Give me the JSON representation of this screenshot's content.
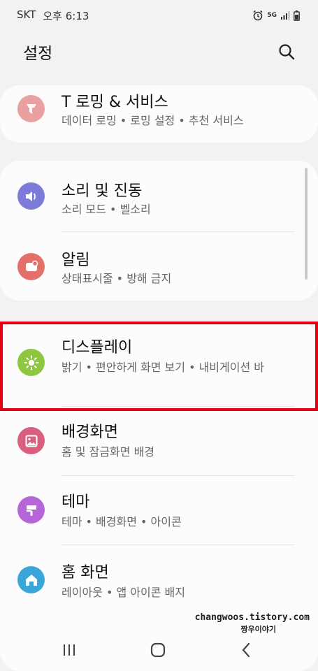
{
  "status_bar": {
    "carrier": "SKT",
    "time": "오후 6:13",
    "network": "5G"
  },
  "header": {
    "title": "설정",
    "search_icon": "search-icon"
  },
  "settings": {
    "troaming": {
      "title": "T 로밍 & 서비스",
      "subtitle": "데이터 로밍 • 로밍 설정 • 추천 서비스",
      "icon": "troaming-icon",
      "color": "#e8a0a0"
    },
    "sound": {
      "title": "소리 및 진동",
      "subtitle": "소리 모드 • 벨소리",
      "icon": "speaker-icon",
      "color": "#7d7bd9"
    },
    "notifications": {
      "title": "알림",
      "subtitle": "상태표시줄 • 방해 금지",
      "icon": "notification-icon",
      "color": "#e4706b"
    },
    "display": {
      "title": "디스플레이",
      "subtitle": "밝기 • 편안하게 화면 보기 • 내비게이션 바",
      "icon": "sun-icon",
      "color": "#8ec63f"
    },
    "wallpaper": {
      "title": "배경화면",
      "subtitle": "홈 및 잠금화면 배경",
      "icon": "image-icon",
      "color": "#d85f7e"
    },
    "themes": {
      "title": "테마",
      "subtitle": "테마 • 배경화면 • 아이콘",
      "icon": "paint-brush-icon",
      "color": "#b565d6"
    },
    "home_screen": {
      "title": "홈 화면",
      "subtitle": "레이아웃 • 앱 아이콘 배지",
      "icon": "home-icon",
      "color": "#3aa6d8"
    }
  },
  "watermark": {
    "line1": "changwoos.tistory.com",
    "line2": "짱우이야기"
  },
  "nav_bar": {
    "recents_icon": "recents-icon",
    "home_icon": "home-button-icon",
    "back_icon": "back-icon"
  }
}
